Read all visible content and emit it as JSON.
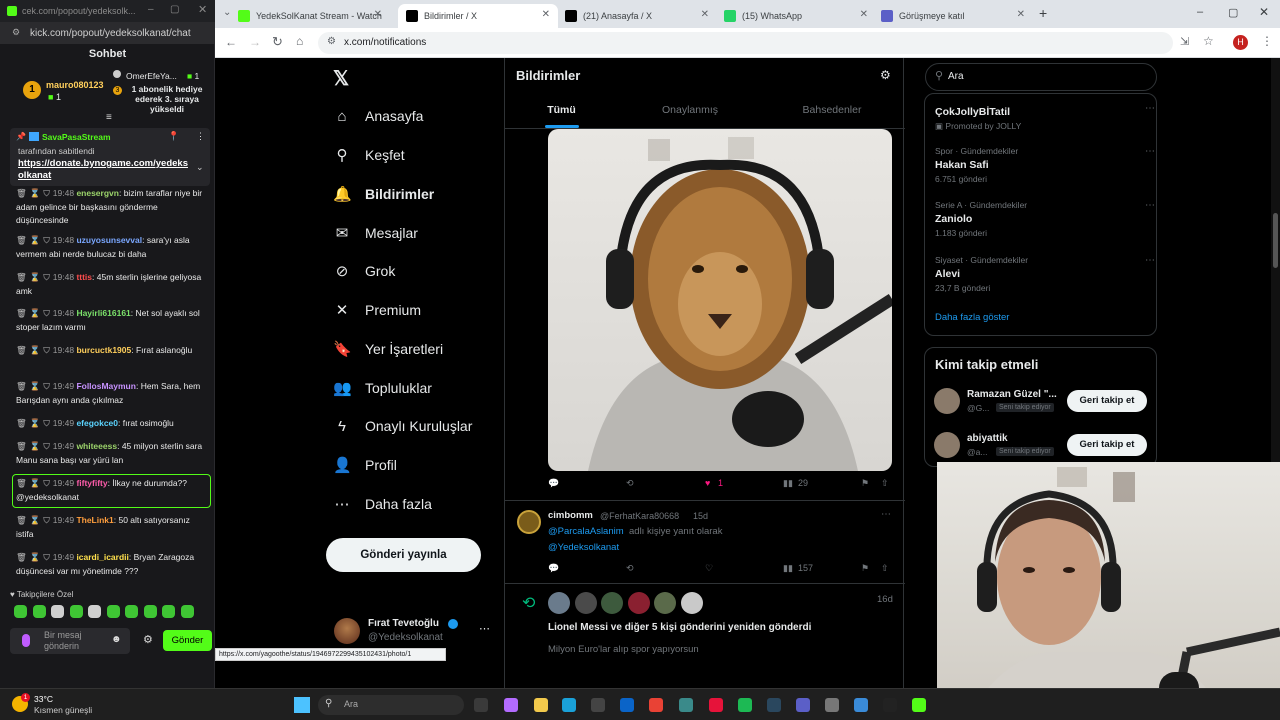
{
  "kick": {
    "window_url": "cek.com/popout/yedeksolk...",
    "url": "kick.com/popout/yedeksolkanat/chat",
    "chat_title": "Sohbet",
    "top_gifter": {
      "name": "mauro080123",
      "count": "1",
      "rank": "1"
    },
    "gift_notice": {
      "user": "OmerEfeYa...",
      "count": "1",
      "text": "1 abonelik hediye ederek 3. sıraya yükseldi",
      "rank": "3"
    },
    "pinned": {
      "user": "SavaPasaStream",
      "label": "tarafından sabitlendi",
      "link": "https://donate.bynogame.com/yedeksolkanat"
    },
    "messages": [
      {
        "time": "19:48",
        "user": "enesergvn",
        "color": "#9cd46b",
        "text": "bizim taraflar niye bir adam gelince bir başkasını gönderme düşüncesinde"
      },
      {
        "time": "19:48",
        "user": "uzuyosunsevval",
        "color": "#7aa7ff",
        "text": "sara'yı asla vermem abi nerde bulucaz bi daha"
      },
      {
        "time": "19:48",
        "user": "tttis",
        "color": "#ff4d4d",
        "text": "45m sterlin işlerine geliyosa amk"
      },
      {
        "time": "19:48",
        "user": "Hayirli616161",
        "color": "#7ce36b",
        "text": "Net sol ayaklı sol stoper lazım varmı"
      },
      {
        "time": "19:48",
        "user": "burcuctk1905",
        "color": "#ffcf5c",
        "text": "Fırat aslanoğlu"
      },
      {
        "time": "19:49",
        "user": "FollosMaymun",
        "color": "#c792ff",
        "text": "Hem Sara, hem Barışdan aynı anda çıkılmaz"
      },
      {
        "time": "19:49",
        "user": "efegokce0",
        "color": "#5bd4ff",
        "text": "fırat osimoğlu"
      },
      {
        "time": "19:49",
        "user": "whiteeess",
        "color": "#9cd46b",
        "text": "45 milyon sterlin sara Manu sana başı var yürü lan"
      },
      {
        "time": "19:49",
        "user": "fiftyfifty",
        "color": "#ff5cab",
        "text": "İlkay ne durumda?? @yedeksolkanat"
      },
      {
        "time": "19:49",
        "user": "TheLink1",
        "color": "#ff9e3d",
        "text": "50 altı satıyorsanız istifa"
      },
      {
        "time": "19:49",
        "user": "icardi_icardii",
        "color": "#ffe14d",
        "text": "Bryan Zaragoza düşüncesi var mı yönetimde ???"
      }
    ],
    "emote_label": "Takipçilere Özel",
    "input_placeholder": "Bir mesaj gönderin",
    "send_label": "Gönder"
  },
  "tabs": [
    {
      "label": "YedekSolKanat Stream - Watch",
      "active": false,
      "color": "#53fc18"
    },
    {
      "label": "Bildirimler / X",
      "active": true,
      "color": "#000000"
    },
    {
      "label": "(21) Anasayfa / X",
      "active": false,
      "color": "#000000"
    },
    {
      "label": "(15) WhatsApp",
      "active": false,
      "color": "#25d366"
    },
    {
      "label": "Görüşmeye katıl",
      "active": false,
      "color": "#5b5fc7"
    }
  ],
  "address": "x.com/notifications",
  "profile_initial": "H",
  "nav": [
    {
      "label": "Anasayfa",
      "icon": "home-icon",
      "glyph": "⌂"
    },
    {
      "label": "Keşfet",
      "icon": "search-icon",
      "glyph": "⚲"
    },
    {
      "label": "Bildirimler",
      "icon": "bell-icon",
      "glyph": "🔔"
    },
    {
      "label": "Mesajlar",
      "icon": "mail-icon",
      "glyph": "✉"
    },
    {
      "label": "Grok",
      "icon": "grok-icon",
      "glyph": "⊘"
    },
    {
      "label": "Premium",
      "icon": "x-premium-icon",
      "glyph": "✕"
    },
    {
      "label": "Yer İşaretleri",
      "icon": "bookmark-icon",
      "glyph": "🔖"
    },
    {
      "label": "Topluluklar",
      "icon": "communities-icon",
      "glyph": "👥"
    },
    {
      "label": "Onaylı Kuruluşlar",
      "icon": "lightning-icon",
      "glyph": "ϟ"
    },
    {
      "label": "Profil",
      "icon": "profile-icon",
      "glyph": "👤"
    },
    {
      "label": "Daha fazla",
      "icon": "more-icon",
      "glyph": "⋯"
    }
  ],
  "post_button": "Gönderi yayınla",
  "account": {
    "name": "Fırat Tevetoğlu",
    "handle": "@Yedeksolkanat"
  },
  "status_url": "https://x.com/yagoothe/status/1946972299435102431/photo/1",
  "notifications": {
    "title": "Bildirimler",
    "tabs": [
      "Tümü",
      "Onaylanmış",
      "Bahsedenler"
    ],
    "post1_stats": {
      "likes": "1",
      "views": "29"
    },
    "reply": {
      "name": "cimbomm",
      "handle": "@FerhatKara80668",
      "age": "15d",
      "reply_prefix": "@ParcalaAslanim",
      "reply_mid": "adlı kişiye yanıt olarak",
      "body": "@Yedeksolkanat",
      "views": "157"
    },
    "repost": {
      "age": "16d",
      "text": "Lionel Messi ve diğer 5 kişi gönderini yeniden gönderdi",
      "preview": "Milyon Euro'lar alıp spor yapıyorsun"
    }
  },
  "search_placeholder": "Ara",
  "trends": [
    {
      "category": "",
      "name": "ÇokJollyBİTatil",
      "count": "Promoted by JOLLY"
    },
    {
      "category": "Spor · Gündemdekiler",
      "name": "Hakan Safi",
      "count": "6.751 gönderi"
    },
    {
      "category": "Serie A · Gündemdekiler",
      "name": "Zaniolo",
      "count": "1.183 gönderi"
    },
    {
      "category": "Siyaset · Gündemdekiler",
      "name": "Alevi",
      "count": "23,7 B gönderi"
    }
  ],
  "show_more": "Daha fazla göster",
  "who_to_follow": {
    "title": "Kimi takip etmeli",
    "users": [
      {
        "name": "Ramazan Güzel \"...",
        "handle": "@G...",
        "badge": "Seni takip ediyor",
        "button": "Geri takip et"
      },
      {
        "name": "abiyattik",
        "handle": "@a...",
        "badge": "Seni takip ediyor",
        "button": "Geri takip et"
      }
    ]
  },
  "taskbar": {
    "temp": "33°C",
    "weather": "Kısmen güneşli",
    "search": "Ara",
    "badge": "1"
  }
}
